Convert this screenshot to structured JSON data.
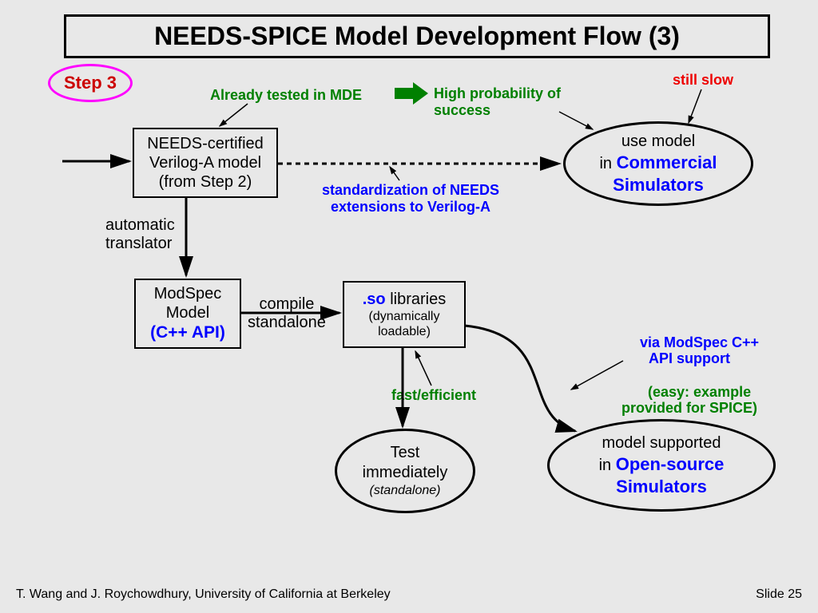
{
  "title": "NEEDS-SPICE Model Development Flow (3)",
  "step_label": "Step 3",
  "annotations": {
    "tested_mde": "Already tested in MDE",
    "high_prob": "High probability of\nsuccess",
    "still_slow": "still slow",
    "standardization": "standardization of NEEDS\nextensions to Verilog-A",
    "auto_trans": "automatic\ntranslator",
    "compile": "compile\nstandalone",
    "fast_eff": "fast/efficient",
    "via_modspec": "via ModSpec C++\nAPI support",
    "easy_example": "(easy: example\nprovided for SPICE)"
  },
  "boxes": {
    "needs_cert": {
      "l1": "NEEDS-certified",
      "l2": "Verilog-A model",
      "l3": "(from Step 2)"
    },
    "modspec": {
      "l1": "ModSpec",
      "l2": "Model",
      "l3": "(C++ API)"
    },
    "so_libs": {
      "l1_prefix": ".so",
      "l1_rest": " libraries",
      "l2": "(dynamically",
      "l3": "loadable)"
    }
  },
  "ellipses": {
    "commercial": {
      "l1": "use model",
      "l2_pre": "in ",
      "l2_em": "Commercial",
      "l3_em": "Simulators"
    },
    "test": {
      "l1": "Test",
      "l2": "immediately",
      "l3": "(standalone)"
    },
    "opensource": {
      "l1": "model supported",
      "l2_pre": "in ",
      "l2_em": "Open-source",
      "l3_em": "Simulators"
    }
  },
  "footer": {
    "left": "T. Wang and J. Roychowdhury, University of California at Berkeley",
    "right": "Slide 25"
  }
}
